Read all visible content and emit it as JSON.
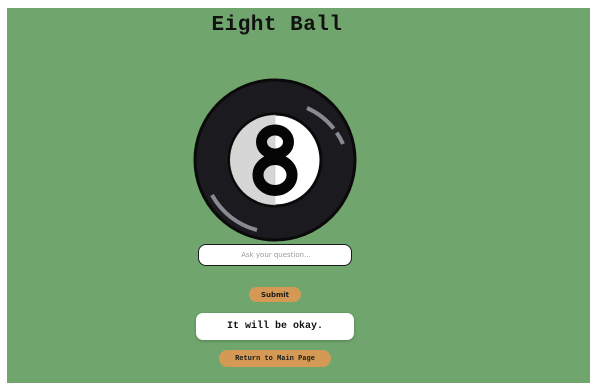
{
  "page": {
    "title": "Eight Ball",
    "background_color": "#70a66e"
  },
  "ball": {
    "number": "8",
    "body_color": "#1b1a1e",
    "outline_color": "#0a0a0a",
    "face_color": "#ffffff",
    "face_shade_color": "#d6d6d6",
    "highlight_color": "#8a8a92"
  },
  "question": {
    "placeholder": "Ask your question...",
    "value": ""
  },
  "submit": {
    "label": "Submit",
    "color": "#d49a55"
  },
  "answer": {
    "text": "It will be okay."
  },
  "return": {
    "label": "Return to Main Page",
    "color": "#d49a55"
  }
}
